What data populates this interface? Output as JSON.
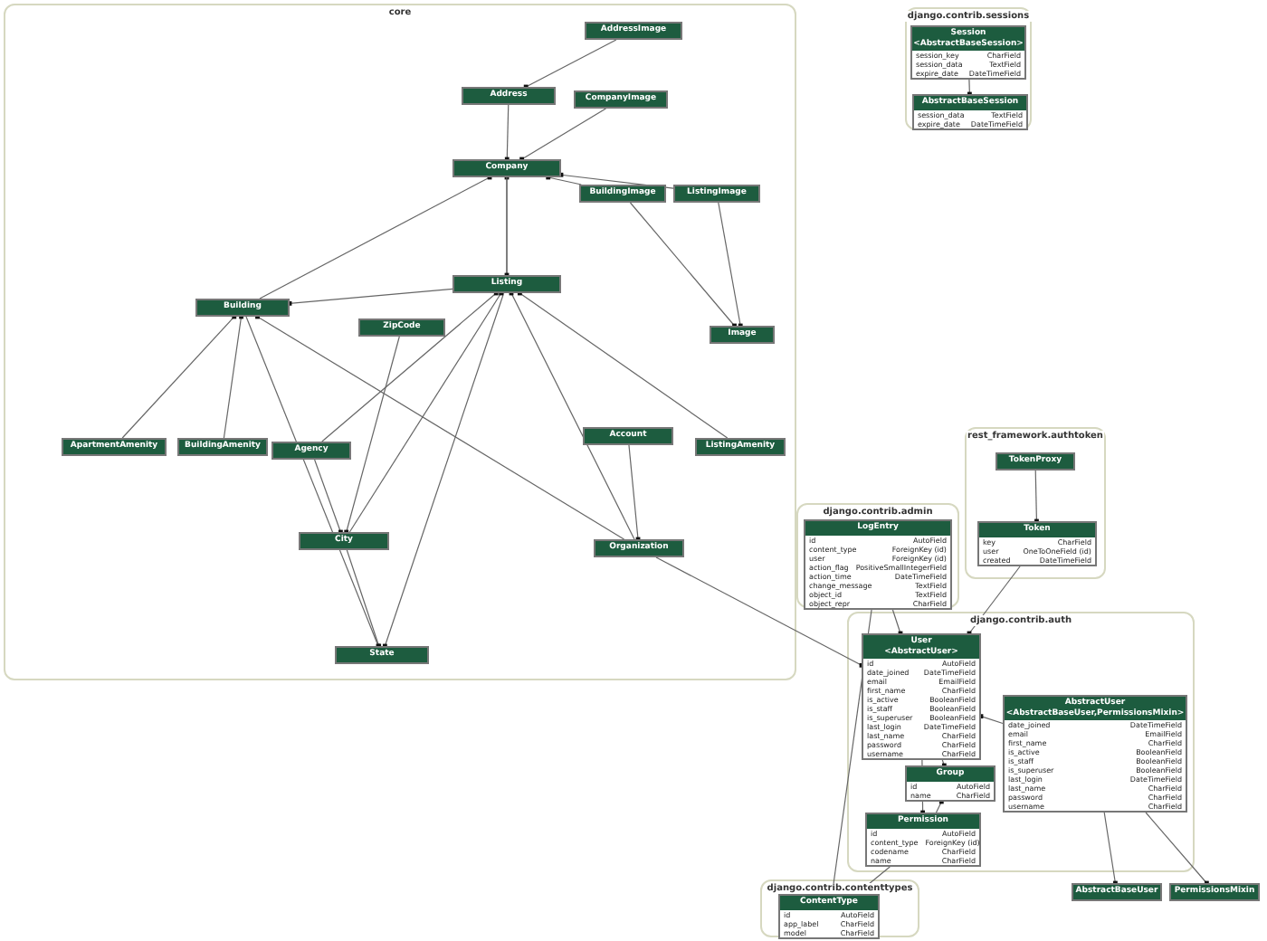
{
  "clusters": [
    {
      "title": "core"
    },
    {
      "title": "django.contrib.sessions"
    },
    {
      "title": "django.contrib.admin"
    },
    {
      "title": "rest_framework.authtoken"
    },
    {
      "title": "django.contrib.auth"
    },
    {
      "title": "django.contrib.contenttypes"
    }
  ],
  "nodes": [
    {
      "title": "AddressImage"
    },
    {
      "title": "Address"
    },
    {
      "title": "CompanyImage"
    },
    {
      "title": "Company"
    },
    {
      "title": "BuildingImage"
    },
    {
      "title": "ListingImage"
    },
    {
      "title": "Building"
    },
    {
      "title": "Listing"
    },
    {
      "title": "ZipCode"
    },
    {
      "title": "Image"
    },
    {
      "title": "ApartmentAmenity"
    },
    {
      "title": "BuildingAmenity"
    },
    {
      "title": "Agency"
    },
    {
      "title": "Account"
    },
    {
      "title": "ListingAmenity"
    },
    {
      "title": "City"
    },
    {
      "title": "Organization"
    },
    {
      "title": "State"
    },
    {
      "title": "Session",
      "subtitle": "<AbstractBaseSession>",
      "fields": [
        {
          "name": "session_key",
          "type": "CharField"
        },
        {
          "name": "session_data",
          "type": "TextField"
        },
        {
          "name": "expire_date",
          "type": "DateTimeField"
        }
      ]
    },
    {
      "title": "AbstractBaseSession",
      "fields": [
        {
          "name": "session_data",
          "type": "TextField"
        },
        {
          "name": "expire_date",
          "type": "DateTimeField"
        }
      ]
    },
    {
      "title": "LogEntry",
      "fields": [
        {
          "name": "id",
          "type": "AutoField"
        },
        {
          "name": "content_type",
          "type": "ForeignKey (id)"
        },
        {
          "name": "user",
          "type": "ForeignKey (id)"
        },
        {
          "name": "action_flag",
          "type": "PositiveSmallIntegerField"
        },
        {
          "name": "action_time",
          "type": "DateTimeField"
        },
        {
          "name": "change_message",
          "type": "TextField"
        },
        {
          "name": "object_id",
          "type": "TextField"
        },
        {
          "name": "object_repr",
          "type": "CharField"
        }
      ]
    },
    {
      "title": "TokenProxy"
    },
    {
      "title": "Token",
      "fields": [
        {
          "name": "key",
          "type": "CharField"
        },
        {
          "name": "user",
          "type": "OneToOneField (id)"
        },
        {
          "name": "created",
          "type": "DateTimeField"
        }
      ]
    },
    {
      "title": "User",
      "subtitle": "<AbstractUser>",
      "fields": [
        {
          "name": "id",
          "type": "AutoField"
        },
        {
          "name": "date_joined",
          "type": "DateTimeField"
        },
        {
          "name": "email",
          "type": "EmailField"
        },
        {
          "name": "first_name",
          "type": "CharField"
        },
        {
          "name": "is_active",
          "type": "BooleanField"
        },
        {
          "name": "is_staff",
          "type": "BooleanField"
        },
        {
          "name": "is_superuser",
          "type": "BooleanField"
        },
        {
          "name": "last_login",
          "type": "DateTimeField"
        },
        {
          "name": "last_name",
          "type": "CharField"
        },
        {
          "name": "password",
          "type": "CharField"
        },
        {
          "name": "username",
          "type": "CharField"
        }
      ]
    },
    {
      "title": "Group",
      "fields": [
        {
          "name": "id",
          "type": "AutoField"
        },
        {
          "name": "name",
          "type": "CharField"
        }
      ]
    },
    {
      "title": "Permission",
      "fields": [
        {
          "name": "id",
          "type": "AutoField"
        },
        {
          "name": "content_type",
          "type": "ForeignKey (id)"
        },
        {
          "name": "codename",
          "type": "CharField"
        },
        {
          "name": "name",
          "type": "CharField"
        }
      ]
    },
    {
      "title": "AbstractUser",
      "subtitle": "<AbstractBaseUser,PermissionsMixin>",
      "fields": [
        {
          "name": "date_joined",
          "type": "DateTimeField"
        },
        {
          "name": "email",
          "type": "EmailField"
        },
        {
          "name": "first_name",
          "type": "CharField"
        },
        {
          "name": "is_active",
          "type": "BooleanField"
        },
        {
          "name": "is_staff",
          "type": "BooleanField"
        },
        {
          "name": "is_superuser",
          "type": "BooleanField"
        },
        {
          "name": "last_login",
          "type": "DateTimeField"
        },
        {
          "name": "last_name",
          "type": "CharField"
        },
        {
          "name": "password",
          "type": "CharField"
        },
        {
          "name": "username",
          "type": "CharField"
        }
      ]
    },
    {
      "title": "AbstractBaseUser"
    },
    {
      "title": "PermissionsMixin"
    },
    {
      "title": "ContentType",
      "fields": [
        {
          "name": "id",
          "type": "AutoField"
        },
        {
          "name": "app_label",
          "type": "CharField"
        },
        {
          "name": "model",
          "type": "CharField"
        }
      ]
    }
  ]
}
